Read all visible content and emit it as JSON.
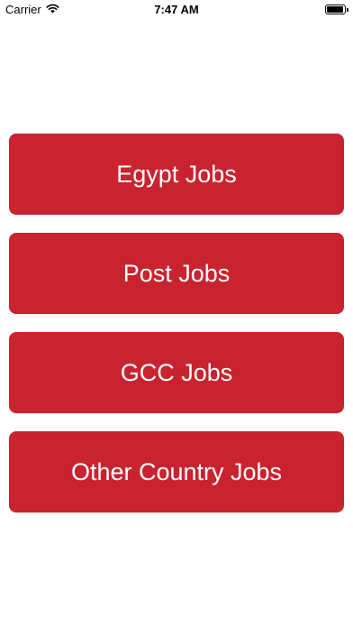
{
  "status_bar": {
    "carrier": "Carrier",
    "time": "7:47 AM",
    "wifi_icon": "wifi-icon",
    "battery_icon": "battery-icon",
    "battery_level": 1.0
  },
  "menu": {
    "buttons": [
      {
        "label": "Egypt Jobs"
      },
      {
        "label": "Post Jobs"
      },
      {
        "label": "GCC Jobs"
      },
      {
        "label": "Other Country Jobs"
      }
    ]
  },
  "colors": {
    "button_background": "#c8232f",
    "button_text": "#ffffff",
    "page_background": "#ffffff"
  }
}
